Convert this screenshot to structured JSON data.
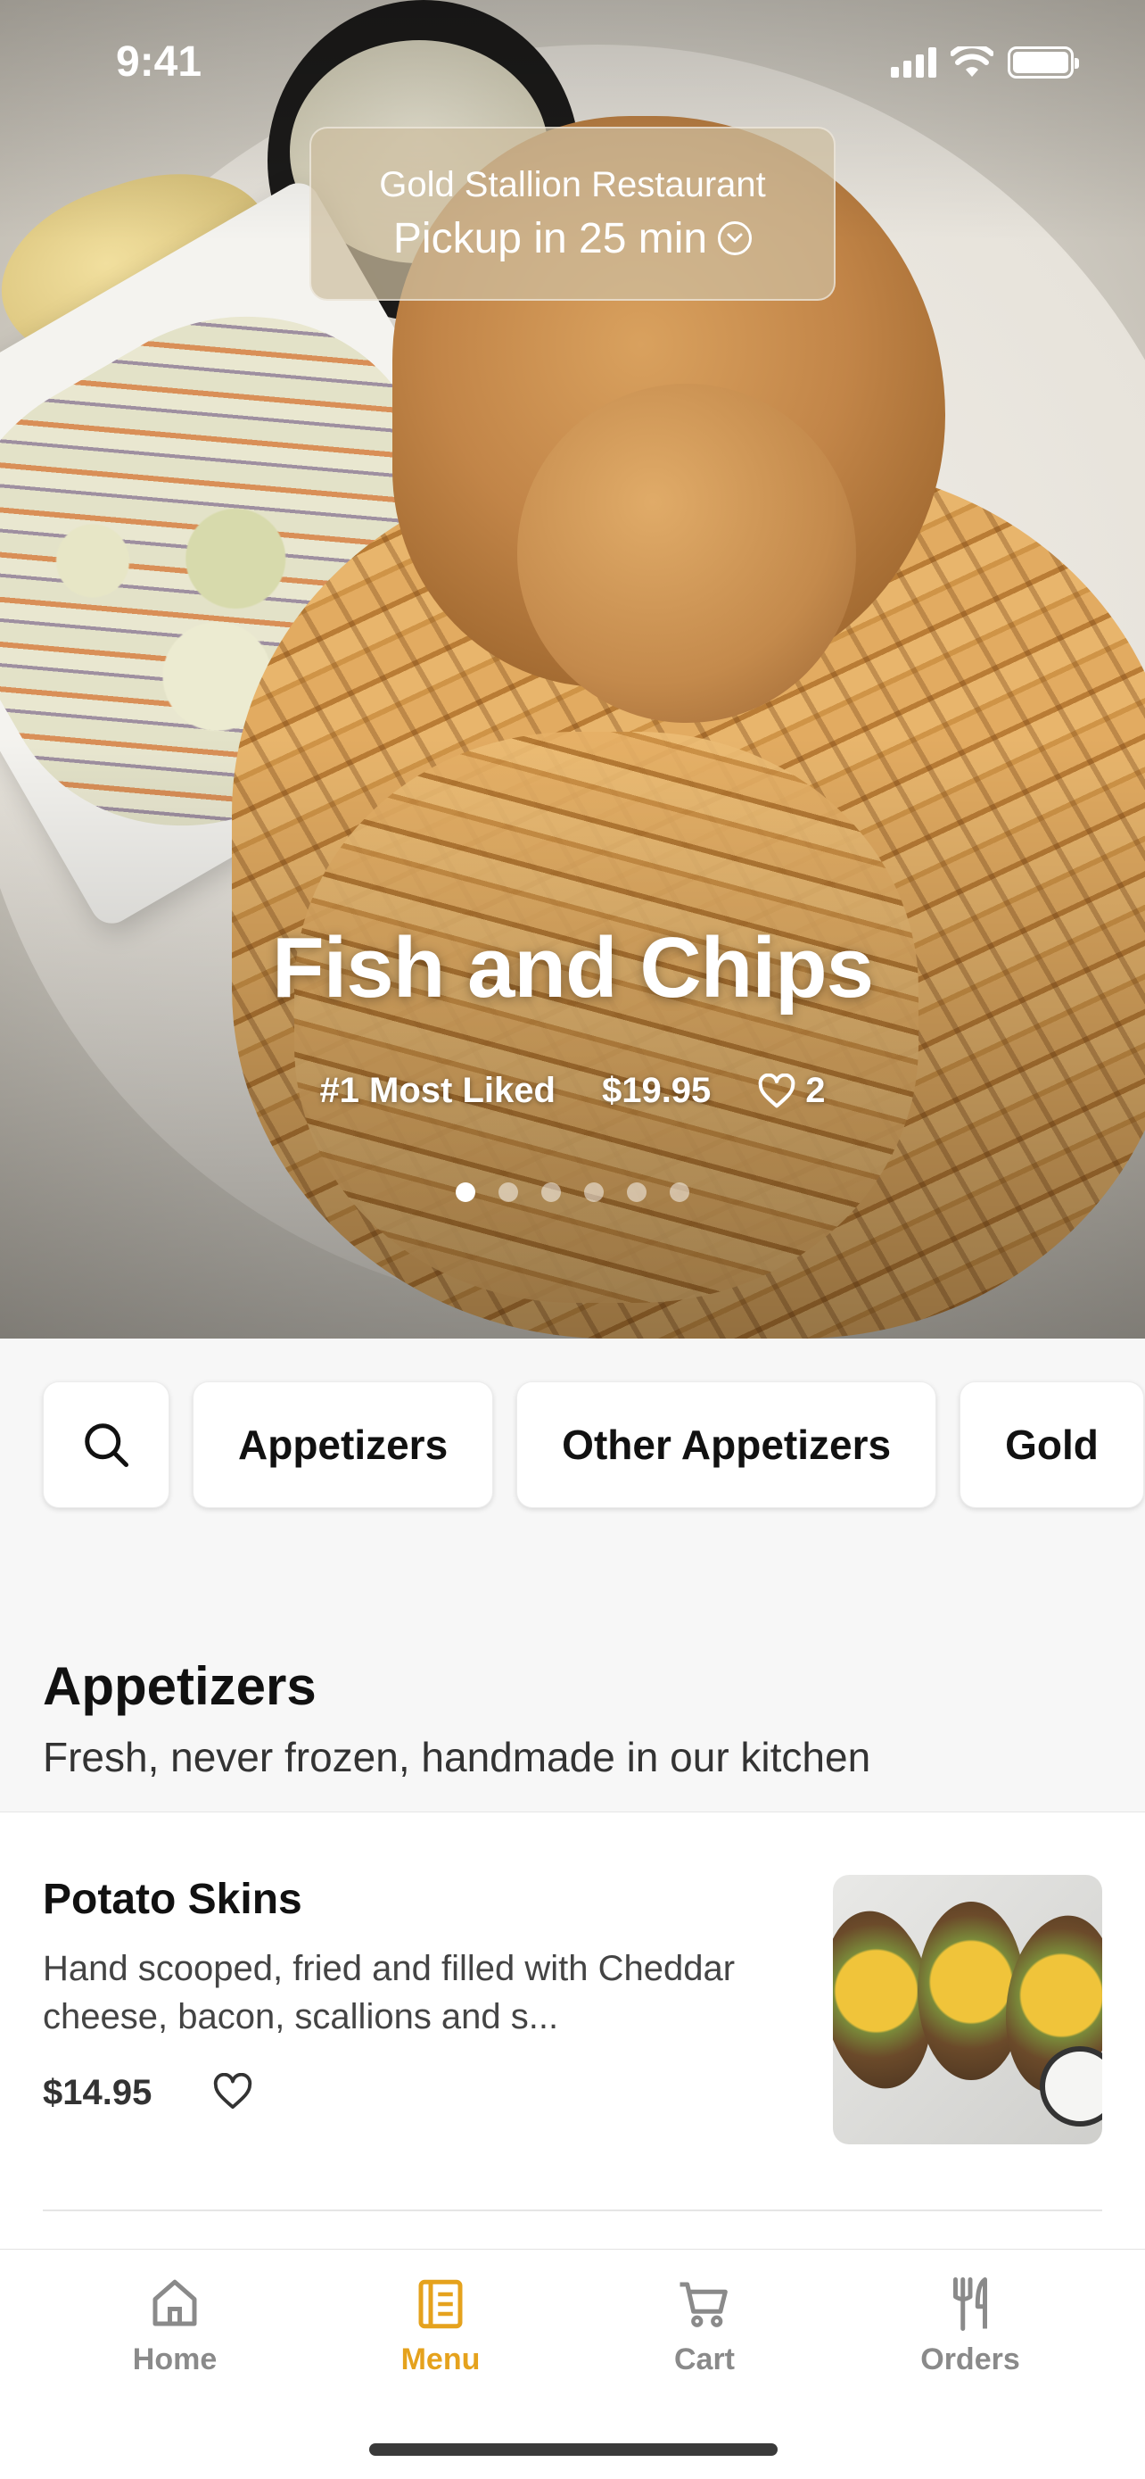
{
  "status_bar": {
    "time": "9:41"
  },
  "restaurant": {
    "name": "Gold Stallion Restaurant",
    "pickup": "Pickup in 25 min"
  },
  "hero": {
    "title": "Fish and Chips",
    "badge": "#1 Most Liked",
    "price": "$19.95",
    "likes": "2",
    "carousel_total": 6,
    "carousel_active": 1
  },
  "categories": [
    "Appetizers",
    "Other Appetizers",
    "Gold"
  ],
  "section": {
    "title": "Appetizers",
    "subtitle": "Fresh, never frozen, handmade in our kitchen"
  },
  "items": [
    {
      "name": "Potato Skins",
      "description": "Hand scooped, fried and filled with Cheddar cheese, bacon, scallions and s...",
      "price": "$14.95"
    }
  ],
  "tabs": [
    {
      "label": "Home",
      "icon": "home-icon",
      "active": false
    },
    {
      "label": "Menu",
      "icon": "menu-icon",
      "active": true
    },
    {
      "label": "Cart",
      "icon": "cart-icon",
      "active": false
    },
    {
      "label": "Orders",
      "icon": "fork-knife-icon",
      "active": false
    }
  ],
  "colors": {
    "accent": "#e5a21d",
    "inactive": "#8a8a8a"
  }
}
